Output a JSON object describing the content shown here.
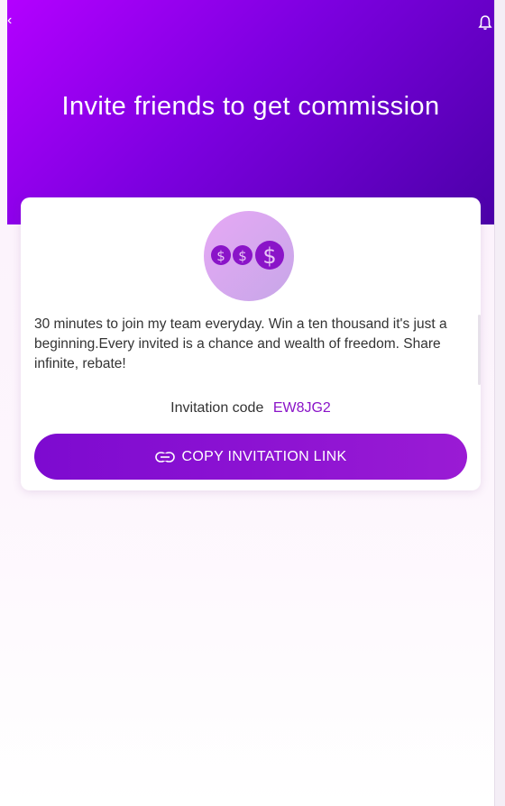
{
  "header": {
    "title": "Invite friends to get commission"
  },
  "icons": {
    "back": "chevron-left-icon",
    "bell": "bell-icon",
    "coins": "dollar-coins-icon",
    "link": "link-icon"
  },
  "card": {
    "description": "30 minutes to join my team everyday. Win a ten thousand it's just a beginning.Every invited is a chance and wealth of freedom. Share infinite, rebate!",
    "code_label": "Invitation code",
    "code_value": "EW8JG2",
    "copy_button_label": "COPY INVITATION LINK"
  },
  "colors": {
    "brand_gradient_start": "#b300ff",
    "brand_gradient_end": "#4b00a8",
    "button": "#8a14c8",
    "code": "#8a14c8"
  }
}
